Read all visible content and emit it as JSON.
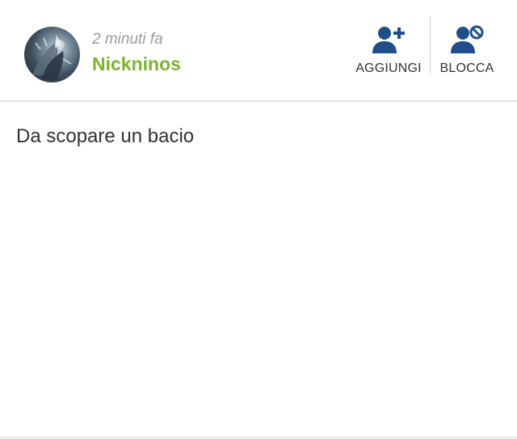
{
  "post": {
    "time": "2 minuti fa",
    "username": "Nickninos",
    "message": "Da scopare un bacio"
  },
  "actions": {
    "add": {
      "label": "AGGIUNGI",
      "icon": "add-user-icon"
    },
    "block": {
      "label": "BLOCCA",
      "icon": "block-user-icon"
    }
  },
  "colors": {
    "username": "#7bb52b",
    "icon": "#1f4e8c",
    "time": "#9a9a9a",
    "text": "#333333"
  }
}
